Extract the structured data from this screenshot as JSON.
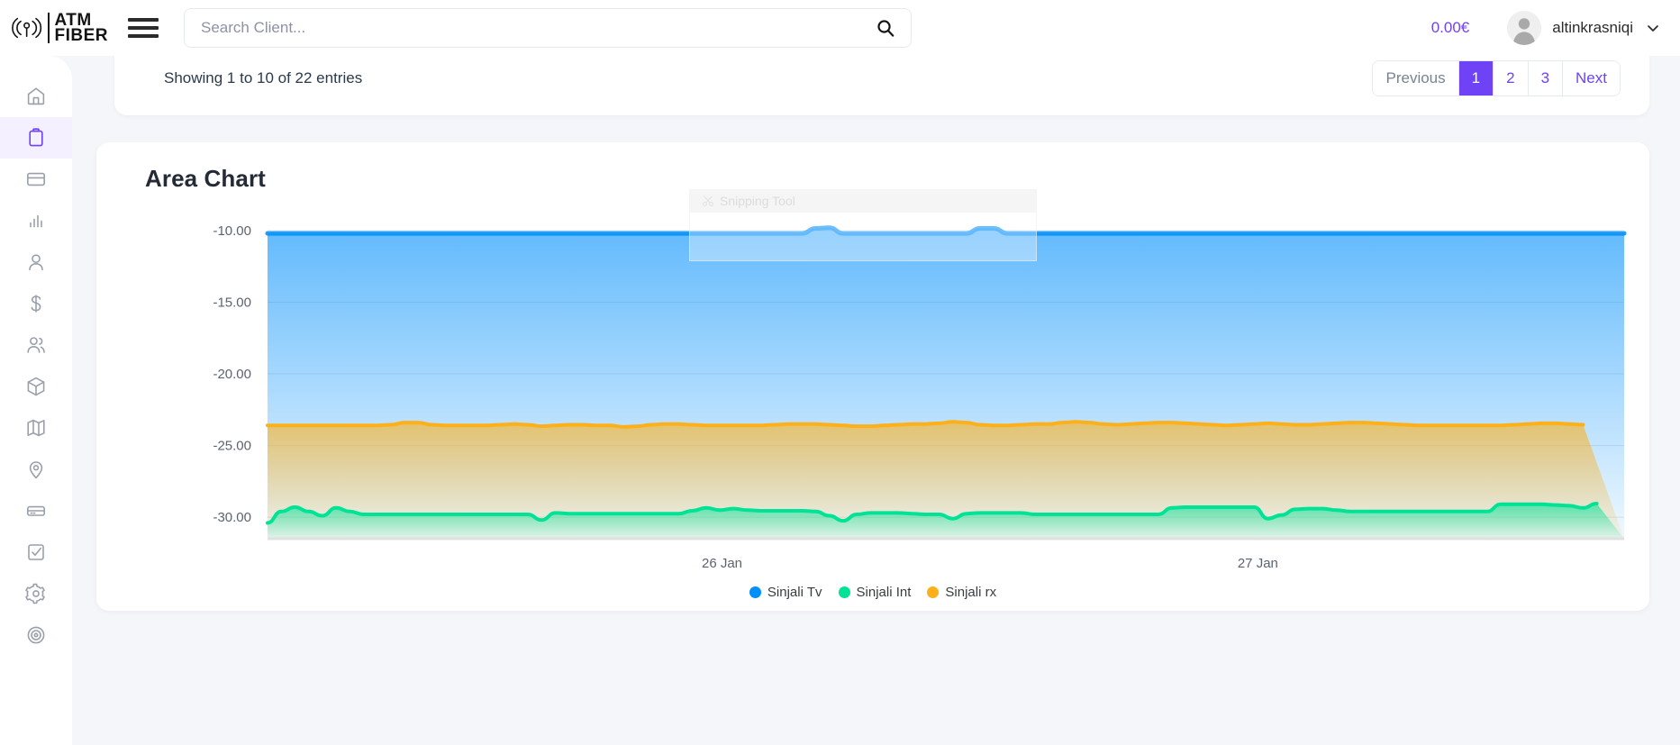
{
  "brand": {
    "icon": "signal-antenna-icon",
    "line1": "ATM",
    "line2": "FIBER"
  },
  "header": {
    "menu_icon": "hamburger-icon",
    "search": {
      "placeholder": "Search Client...",
      "value": "",
      "icon": "search-icon"
    },
    "balance": "0.00€",
    "balance_color": "#6F42F5",
    "user": {
      "name": "altinkrasniqi",
      "avatar_icon": "user-avatar-icon",
      "chevron_icon": "chevron-down-icon"
    }
  },
  "sidebar": {
    "items": [
      {
        "icon": "home-icon",
        "label": "Home",
        "active": false
      },
      {
        "icon": "clipboard-icon",
        "label": "Orders",
        "active": true
      },
      {
        "icon": "credit-card-icon",
        "label": "Billing",
        "active": false
      },
      {
        "icon": "bar-chart-icon",
        "label": "Reports",
        "active": false
      },
      {
        "icon": "user-icon",
        "label": "Profile",
        "active": false
      },
      {
        "icon": "dollar-icon",
        "label": "Payments",
        "active": false
      },
      {
        "icon": "users-icon",
        "label": "Clients",
        "active": false
      },
      {
        "icon": "package-icon",
        "label": "Inventory",
        "active": false
      },
      {
        "icon": "map-icon",
        "label": "Map",
        "active": false
      },
      {
        "icon": "map-pin-icon",
        "label": "Locations",
        "active": false
      },
      {
        "icon": "server-icon",
        "label": "Devices",
        "active": false
      },
      {
        "icon": "check-square-icon",
        "label": "Tasks",
        "active": false
      },
      {
        "icon": "gear-icon",
        "label": "Settings",
        "active": false
      },
      {
        "icon": "target-icon",
        "label": "Targets",
        "active": false
      }
    ],
    "active_color": "#6F42F5",
    "active_bg": "#F4F0FF"
  },
  "table_footer": {
    "entries_text": "Showing 1 to 10 of 22 entries",
    "pagination": [
      {
        "label": "Previous",
        "active": false,
        "muted": true
      },
      {
        "label": "1",
        "active": true,
        "muted": false
      },
      {
        "label": "2",
        "active": false,
        "muted": false
      },
      {
        "label": "3",
        "active": false,
        "muted": false
      },
      {
        "label": "Next",
        "active": false,
        "muted": false
      }
    ]
  },
  "overlay": {
    "title": "Snipping Tool",
    "icon": "scissors-icon"
  },
  "chart_data": {
    "type": "area",
    "title": "Area Chart",
    "xlabel": "",
    "ylabel": "",
    "grid": true,
    "legend_position": "bottom",
    "ylim": [
      -31.5,
      -9.0
    ],
    "yticks": [
      "-10.00",
      "-15.00",
      "-20.00",
      "-25.00",
      "-30.00"
    ],
    "ytick_values": [
      -10,
      -15,
      -20,
      -25,
      -30
    ],
    "xtick_labels": [
      "26 Jan",
      "27 Jan"
    ],
    "xtick_positions": [
      0.335,
      0.73
    ],
    "colors": {
      "Sinjali Tv": "#008FFB",
      "Sinjali Int": "#00E396",
      "Sinjali rx": "#FEB019"
    },
    "series": [
      {
        "name": "Sinjali Tv",
        "color": "#008FFB",
        "values": [
          -10.2,
          -10.2,
          -10.2,
          -10.2,
          -10.2,
          -10.2,
          -10.2,
          -10.2,
          -10.2,
          -10.2,
          -10.2,
          -10.2,
          -10.2,
          -10.2,
          -10.2,
          -10.2,
          -10.2,
          -10.2,
          -10.2,
          -10.2,
          -10.2,
          -10.2,
          -10.2,
          -10.2,
          -10.2,
          -10.2,
          -10.2,
          -10.2,
          -10.2,
          -10.2,
          -10.2,
          -10.2,
          -10.2,
          -10.2,
          -10.2,
          -10.2,
          -10.2,
          -10.2,
          -10.2,
          -10.2,
          -9.85,
          -9.8,
          -10.2,
          -10.2,
          -10.2,
          -10.2,
          -10.2,
          -10.2,
          -10.2,
          -10.2,
          -10.2,
          -10.2,
          -9.85,
          -9.85,
          -10.2,
          -10.2,
          -10.2,
          -10.2,
          -10.2,
          -10.2,
          -10.2,
          -10.2,
          -10.2,
          -10.2,
          -10.2,
          -10.2,
          -10.2,
          -10.2,
          -10.2,
          -10.2,
          -10.2,
          -10.2,
          -10.2,
          -10.2,
          -10.2,
          -10.2,
          -10.2,
          -10.2,
          -10.2,
          -10.2,
          -10.2,
          -10.2,
          -10.2,
          -10.2,
          -10.2,
          -10.2,
          -10.2,
          -10.2,
          -10.2,
          -10.2,
          -10.2,
          -10.2,
          -10.2,
          -10.2,
          -10.2,
          -10.2,
          -10.2,
          -10.2,
          -10.2,
          -10.2
        ]
      },
      {
        "name": "Sinjali Int",
        "color": "#00E396",
        "values": [
          -30.4,
          -29.6,
          -29.3,
          -29.6,
          -29.9,
          -29.35,
          -29.6,
          -29.8,
          -29.8,
          -29.8,
          -29.8,
          -29.8,
          -29.8,
          -29.8,
          -29.8,
          -29.8,
          -29.8,
          -29.8,
          -29.8,
          -29.8,
          -30.2,
          -29.7,
          -29.75,
          -29.75,
          -29.75,
          -29.75,
          -29.75,
          -29.75,
          -29.75,
          -29.75,
          -29.75,
          -29.55,
          -29.35,
          -29.5,
          -29.4,
          -29.5,
          -29.55,
          -29.55,
          -29.55,
          -29.55,
          -29.6,
          -29.9,
          -30.25,
          -29.8,
          -29.7,
          -29.7,
          -29.7,
          -29.75,
          -29.8,
          -29.8,
          -30.1,
          -29.75,
          -29.7,
          -29.7,
          -29.7,
          -29.7,
          -29.8,
          -29.8,
          -29.8,
          -29.8,
          -29.8,
          -29.8,
          -29.8,
          -29.8,
          -29.8,
          -29.8,
          -29.35,
          -29.3,
          -29.3,
          -29.3,
          -29.3,
          -29.3,
          -29.3,
          -30.1,
          -29.85,
          -29.45,
          -29.4,
          -29.4,
          -29.5,
          -29.6,
          -29.6,
          -29.6,
          -29.6,
          -29.6,
          -29.6,
          -29.6,
          -29.6,
          -29.6,
          -29.6,
          -29.6,
          -29.1,
          -29.1,
          -29.1,
          -29.1,
          -29.15,
          -29.2,
          -29.35,
          -29.05
        ]
      },
      {
        "name": "Sinjali rx",
        "color": "#FEB019",
        "values": [
          -23.6,
          -23.6,
          -23.6,
          -23.6,
          -23.6,
          -23.6,
          -23.6,
          -23.6,
          -23.6,
          -23.55,
          -23.4,
          -23.4,
          -23.55,
          -23.6,
          -23.6,
          -23.6,
          -23.6,
          -23.55,
          -23.5,
          -23.55,
          -23.65,
          -23.6,
          -23.55,
          -23.55,
          -23.6,
          -23.6,
          -23.7,
          -23.65,
          -23.55,
          -23.5,
          -23.5,
          -23.55,
          -23.6,
          -23.6,
          -23.6,
          -23.6,
          -23.6,
          -23.55,
          -23.5,
          -23.5,
          -23.5,
          -23.55,
          -23.6,
          -23.65,
          -23.65,
          -23.6,
          -23.55,
          -23.5,
          -23.5,
          -23.45,
          -23.35,
          -23.4,
          -23.55,
          -23.6,
          -23.6,
          -23.55,
          -23.5,
          -23.5,
          -23.4,
          -23.35,
          -23.4,
          -23.5,
          -23.55,
          -23.5,
          -23.45,
          -23.4,
          -23.4,
          -23.45,
          -23.5,
          -23.55,
          -23.6,
          -23.55,
          -23.5,
          -23.45,
          -23.5,
          -23.55,
          -23.55,
          -23.5,
          -23.45,
          -23.4,
          -23.4,
          -23.45,
          -23.5,
          -23.55,
          -23.6,
          -23.6,
          -23.6,
          -23.6,
          -23.6,
          -23.6,
          -23.6,
          -23.55,
          -23.5,
          -23.45,
          -23.45,
          -23.5,
          -23.55
        ]
      }
    ],
    "legend": [
      {
        "label": "Sinjali Tv",
        "color": "#008FFB"
      },
      {
        "label": "Sinjali Int",
        "color": "#00E396"
      },
      {
        "label": "Sinjali rx",
        "color": "#FEB019"
      }
    ]
  }
}
